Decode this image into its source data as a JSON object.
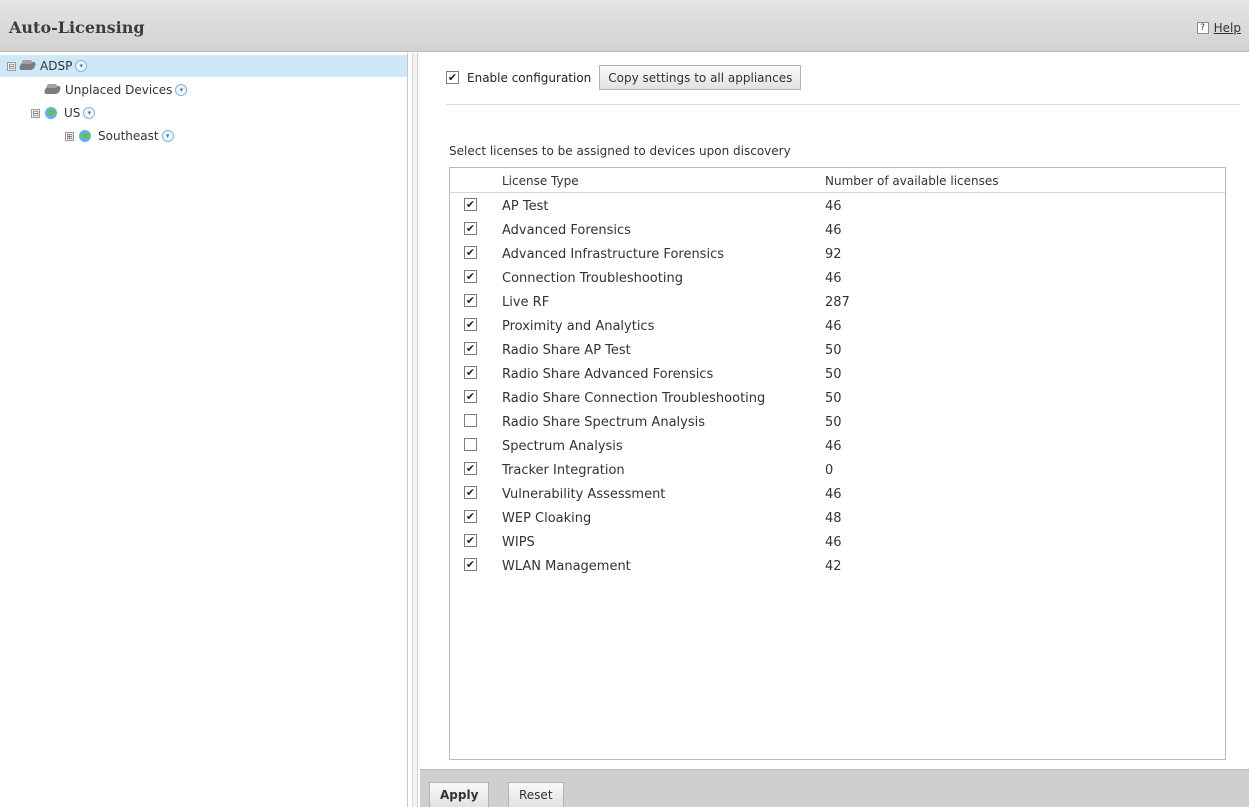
{
  "header": {
    "title": "Auto-Licensing",
    "help_icon": "?",
    "help_label": "Help"
  },
  "tree": [
    {
      "label": "ADSP",
      "icon": "device-icon",
      "expander": "⊟",
      "selected": true
    },
    {
      "label": "Unplaced Devices",
      "icon": "device-icon"
    },
    {
      "label": "US",
      "icon": "globe-icon",
      "expander": "⊟"
    },
    {
      "label": "Southeast",
      "icon": "globe-icon",
      "expander": "⊞"
    }
  ],
  "config": {
    "enable_label": "Enable configuration",
    "enable_checked": true,
    "copy_button": "Copy settings to all appliances"
  },
  "licenses": {
    "prompt": "Select licenses to be assigned to devices upon discovery",
    "col_type": "License Type",
    "col_count": "Number of available licenses",
    "rows": [
      {
        "name": "AP Test",
        "count": "46",
        "checked": true
      },
      {
        "name": "Advanced Forensics",
        "count": "46",
        "checked": true
      },
      {
        "name": "Advanced Infrastructure Forensics",
        "count": "92",
        "checked": true
      },
      {
        "name": "Connection Troubleshooting",
        "count": "46",
        "checked": true
      },
      {
        "name": "Live RF",
        "count": "287",
        "checked": true
      },
      {
        "name": "Proximity and Analytics",
        "count": "46",
        "checked": true
      },
      {
        "name": "Radio Share AP Test",
        "count": "50",
        "checked": true
      },
      {
        "name": "Radio Share Advanced Forensics",
        "count": "50",
        "checked": true
      },
      {
        "name": "Radio Share Connection Troubleshooting",
        "count": "50",
        "checked": true
      },
      {
        "name": "Radio Share Spectrum Analysis",
        "count": "50",
        "checked": false
      },
      {
        "name": "Spectrum Analysis",
        "count": "46",
        "checked": false
      },
      {
        "name": "Tracker Integration",
        "count": "0",
        "checked": true
      },
      {
        "name": "Vulnerability Assessment",
        "count": "46",
        "checked": true
      },
      {
        "name": "WEP Cloaking",
        "count": "48",
        "checked": true
      },
      {
        "name": "WIPS",
        "count": "46",
        "checked": true
      },
      {
        "name": "WLAN Management",
        "count": "42",
        "checked": true
      }
    ]
  },
  "footer": {
    "apply": "Apply",
    "reset": "Reset"
  },
  "glyphs": {
    "check": "✔",
    "dropdown": "▾"
  }
}
